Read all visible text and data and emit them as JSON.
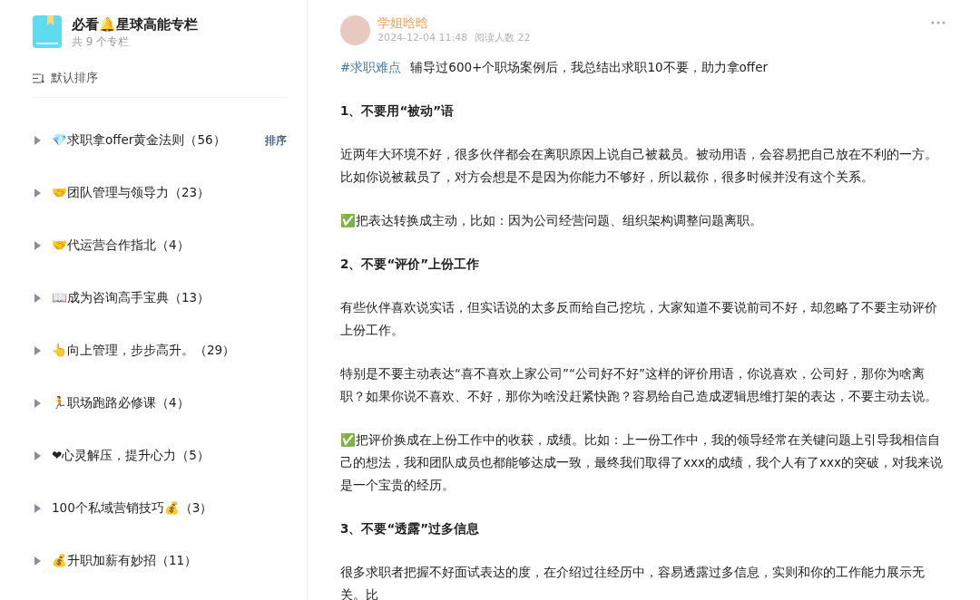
{
  "sidebar": {
    "title": "必看🔔星球高能专栏",
    "subtitle": "共 9 个专栏",
    "sort_label": "默认排序",
    "items": [
      {
        "label": "💎求职拿offer黄金法则（56）",
        "action": "排序",
        "expanded": false
      },
      {
        "label": "🤝团队管理与领导力（23）",
        "expanded": false
      },
      {
        "label": "🤝代运营合作指北（4）",
        "expanded": false
      },
      {
        "label": "📖成为咨询高手宝典（13）",
        "expanded": false
      },
      {
        "label": "👆向上管理，步步高升。（29）",
        "expanded": false
      },
      {
        "label": "🏃职场跑路必修课（4）",
        "expanded": false
      },
      {
        "label": "❤心灵解压，提升心力（5）",
        "expanded": false
      },
      {
        "label": "100个私域营销技巧💰（3）",
        "expanded": false
      },
      {
        "label": "💰升职加薪有妙招（11）",
        "expanded": false
      }
    ]
  },
  "post": {
    "author": "学姐晗晗",
    "date": "2024-12-04 11:48",
    "reads": "阅读人数 22",
    "tag": "#求职难点",
    "intro": "辅导过600+个职场案例后，我总结出求职10不要，助力拿offer",
    "blocks": [
      {
        "kind": "heading",
        "text": "1、不要用“被动”语"
      },
      {
        "kind": "paragraph",
        "text": "近两年大环境不好，很多伙伴都会在离职原因上说自己被裁员。被动用语，会容易把自己放在不利的一方。比如你说被裁员了，对方会想是不是因为你能力不够好，所以裁你，很多时候并没有这个关系。"
      },
      {
        "kind": "paragraph",
        "text": "✅把表达转换成主动，比如：因为公司经营问题、组织架构调整问题离职。"
      },
      {
        "kind": "heading",
        "text": "2、不要“评价”上份工作"
      },
      {
        "kind": "paragraph",
        "text": "有些伙伴喜欢说实话，但实话说的太多反而给自己挖坑，大家知道不要说前司不好，却忽略了不要主动评价上份工作。"
      },
      {
        "kind": "paragraph",
        "text": "特别是不要主动表达“喜不喜欢上家公司”“公司好不好”这样的评价用语，你说喜欢，公司好，那你为啥离职？如果你说不喜欢、不好，那你为啥没赶紧快跑？容易给自己造成逻辑思维打架的表达，不要主动去说。"
      },
      {
        "kind": "paragraph",
        "text": "✅把评价换成在上份工作中的收获，成绩。比如：上一份工作中，我的领导经常在关键问题上引导我相信自己的想法，我和团队成员也都能够达成一致，最终我们取得了xxx的成绩，我个人有了xxx的突破，对我来说是一个宝贵的经历。"
      },
      {
        "kind": "heading",
        "text": "3、不要“透露”过多信息"
      },
      {
        "kind": "paragraph",
        "text": "很多求职者把握不好面试表达的度，在介绍过往经历中，容易透露过多信息，实则和你的工作能力展示无关。比"
      }
    ]
  }
}
